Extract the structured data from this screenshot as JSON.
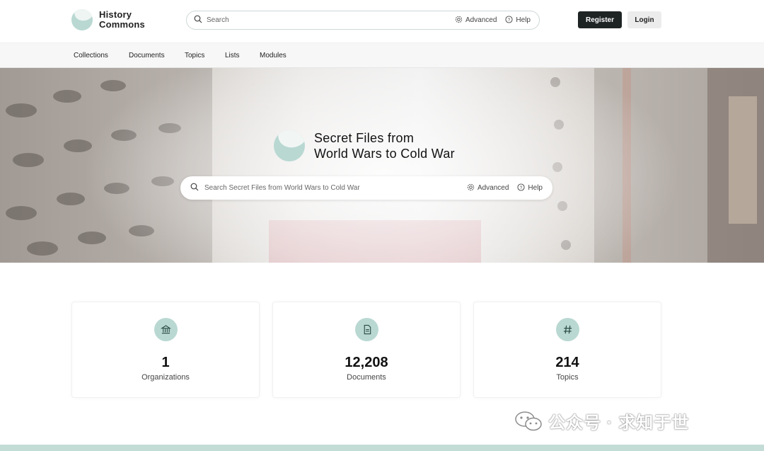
{
  "header": {
    "logo_line1": "History",
    "logo_line2": "Commons",
    "search_placeholder": "Search",
    "advanced_label": "Advanced",
    "help_label": "Help",
    "register_label": "Register",
    "login_label": "Login"
  },
  "nav": {
    "items": [
      "Collections",
      "Documents",
      "Topics",
      "Lists",
      "Modules"
    ]
  },
  "hero": {
    "title_line1": "Secret Files from",
    "title_line2": "World Wars to Cold War",
    "search_placeholder": "Search Secret Files from World Wars to Cold War",
    "advanced_label": "Advanced",
    "help_label": "Help"
  },
  "stats": [
    {
      "value": "1",
      "label": "Organizations",
      "icon": "bank-icon"
    },
    {
      "value": "12,208",
      "label": "Documents",
      "icon": "document-icon"
    },
    {
      "value": "214",
      "label": "Topics",
      "icon": "hash-icon"
    }
  ],
  "watermark": {
    "text": "公众号 · 求知于世"
  },
  "colors": {
    "accent": "#b9d8d2",
    "dark_button": "#1e2424",
    "footer": "#c4dcd6"
  }
}
